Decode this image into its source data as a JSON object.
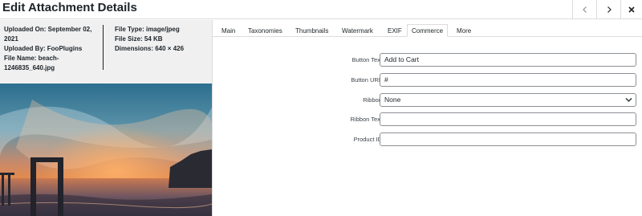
{
  "header": {
    "title": "Edit Attachment Details",
    "prev_icon": "chevron-left-icon",
    "next_icon": "chevron-right-icon",
    "close_icon": "close-icon"
  },
  "details": {
    "uploaded_on": "Uploaded On: September 02, 2021",
    "uploaded_by": "Uploaded By: FooPlugins",
    "file_name": "File Name: beach-1246835_640.jpg",
    "file_type": "File Type: image/jpeg",
    "file_size": "File Size: 54 KB",
    "dimensions": "Dimensions: 640 × 426"
  },
  "tabs": [
    {
      "label": "Main"
    },
    {
      "label": "Taxonomies"
    },
    {
      "label": "Thumbnails"
    },
    {
      "label": "Watermark"
    },
    {
      "label": "EXIF"
    },
    {
      "label": "Commerce",
      "active": true
    },
    {
      "label": "More"
    }
  ],
  "form": {
    "button_text": {
      "label": "Button Text",
      "value": "Add to Cart"
    },
    "button_url": {
      "label": "Button URL",
      "value": "#"
    },
    "ribbon": {
      "label": "Ribbon",
      "value": "None"
    },
    "ribbon_text": {
      "label": "Ribbon Text",
      "value": ""
    },
    "product_id": {
      "label": "Product ID",
      "value": ""
    }
  },
  "colors": {
    "sidebar_bg": "#f0f0f1",
    "border": "#dcdcde",
    "text": "#1d2327"
  }
}
